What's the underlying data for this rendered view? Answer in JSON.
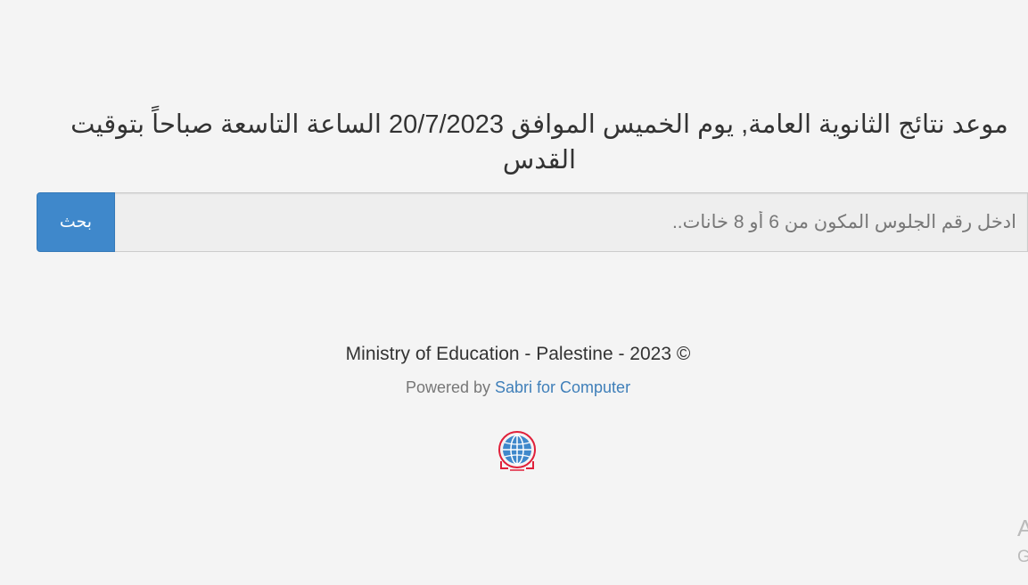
{
  "headline": "موعد نتائج الثانوية العامة, يوم الخميس الموافق 20/7/2023 الساعة التاسعة صباحاً بتوقيت القدس",
  "search": {
    "button_label": "بحث",
    "placeholder": "ادخل رقم الجلوس المكون من 6 أو 8 خانات..",
    "value": ""
  },
  "footer": {
    "copyright": "Ministry of Education - Palestine - 2023 ©",
    "powered_prefix": "Powered by ",
    "powered_link": "Sabri for Computer"
  },
  "logo": {
    "icon": "globe-logo-icon",
    "colors": {
      "globe": "#3f88cb",
      "ring": "#e0203a"
    }
  },
  "edge_fragments": {
    "upper": "A",
    "lower": "G"
  }
}
